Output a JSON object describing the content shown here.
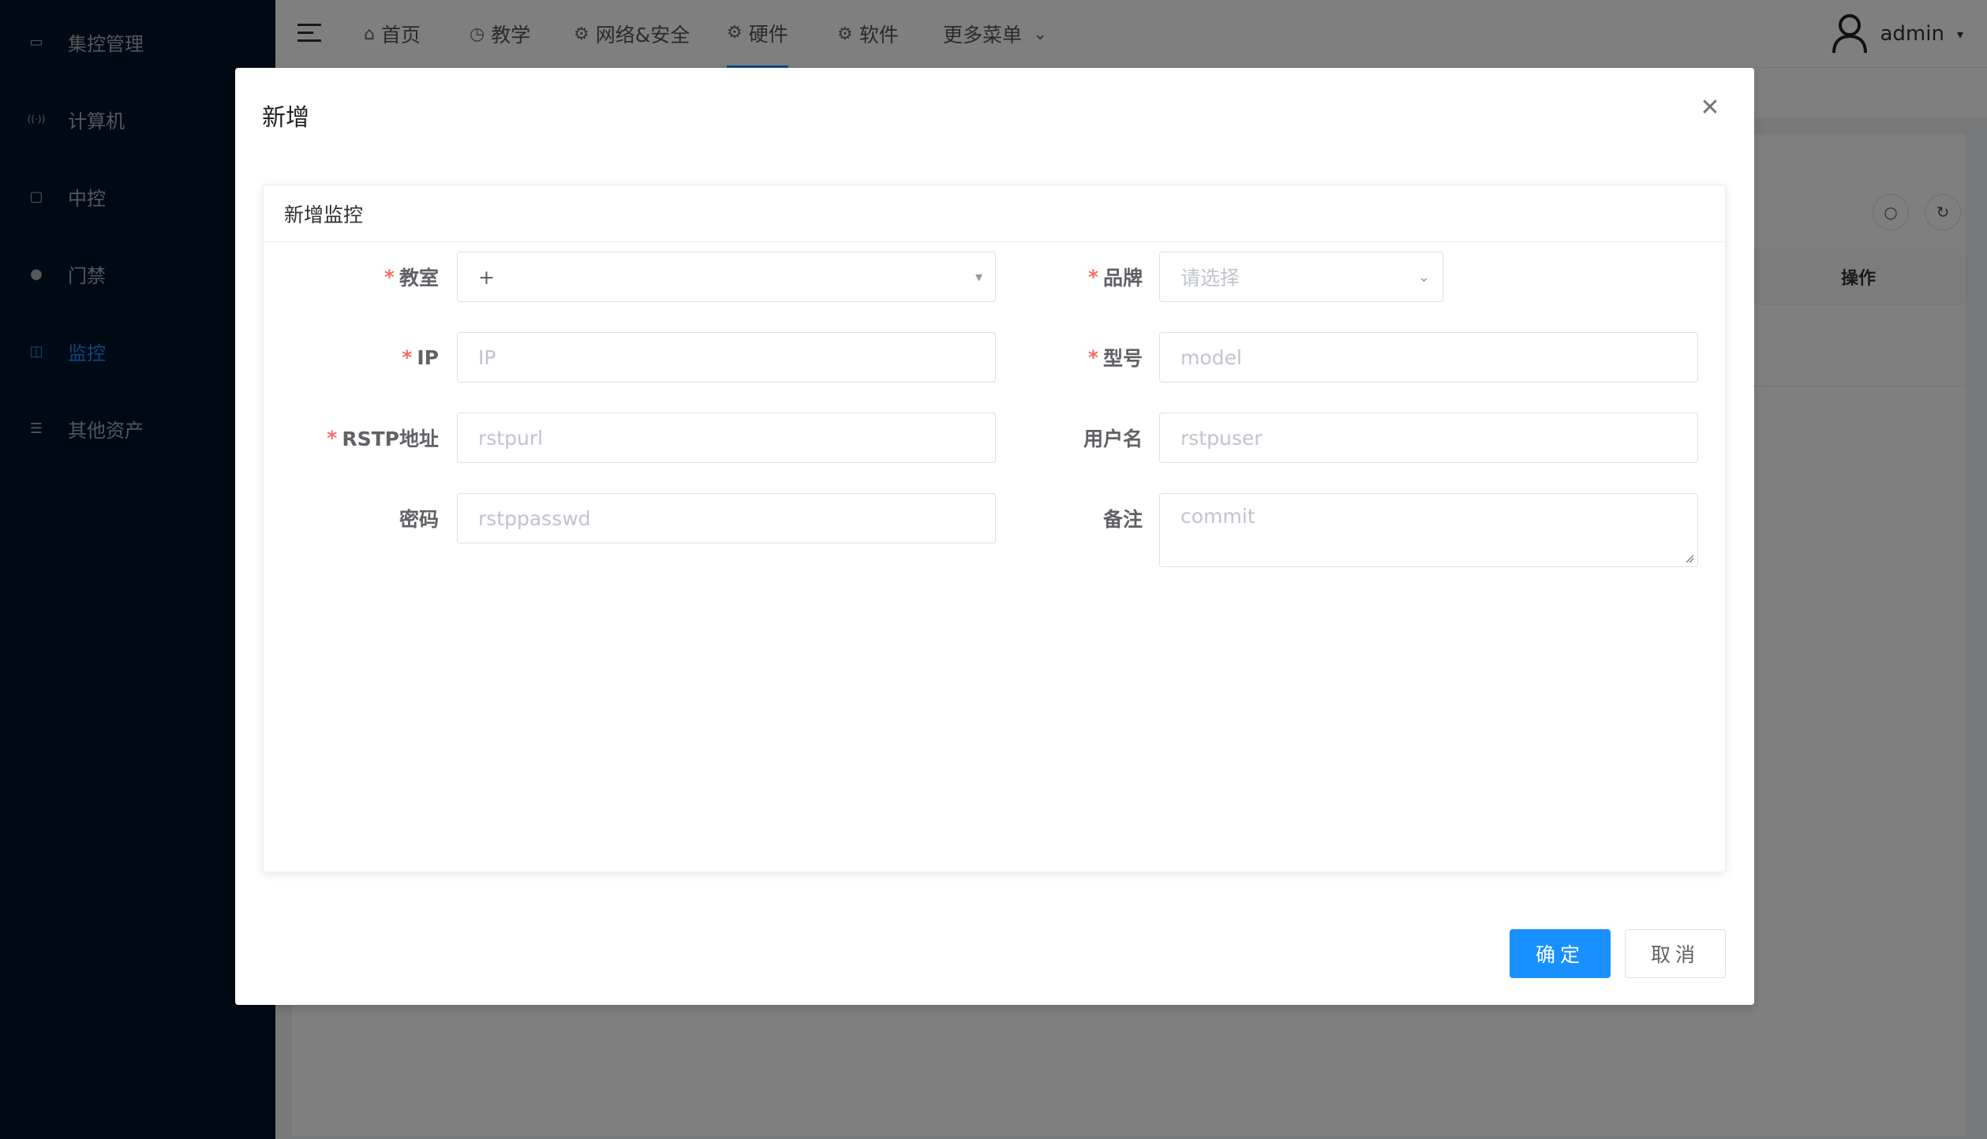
{
  "sidebar": {
    "items": [
      {
        "label": "集控管理",
        "icon": "briefcase-icon",
        "glyph": "▭"
      },
      {
        "label": "计算机",
        "icon": "broadcast-icon",
        "glyph": "((·))"
      },
      {
        "label": "中控",
        "icon": "monitor-icon",
        "glyph": "▢"
      },
      {
        "label": "门禁",
        "icon": "user-icon",
        "glyph": "●"
      },
      {
        "label": "监控",
        "icon": "camera-icon",
        "glyph": "◫"
      },
      {
        "label": "其他资产",
        "icon": "list-icon",
        "glyph": "☰"
      }
    ],
    "active_index": 4
  },
  "header": {
    "nav": [
      {
        "label": "首页",
        "icon": "home-icon",
        "glyph": "⌂"
      },
      {
        "label": "教学",
        "icon": "clock-icon",
        "glyph": "◷"
      },
      {
        "label": "网络&安全",
        "icon": "gear-icon",
        "glyph": "⚙"
      },
      {
        "label": "硬件",
        "icon": "gear-icon",
        "glyph": "⚙"
      },
      {
        "label": "软件",
        "icon": "gear-icon",
        "glyph": "⚙"
      },
      {
        "label": "更多菜单",
        "icon": "chevron-down-icon",
        "glyph": "⌄"
      }
    ],
    "active_index": 3,
    "user": {
      "name": "admin",
      "caret": "▾"
    }
  },
  "table": {
    "action_header": "操作",
    "search_glyph": "○",
    "refresh_glyph": "↻"
  },
  "modal": {
    "title": "新增",
    "close_glyph": "✕",
    "section_title": "新增监控",
    "fields": {
      "classroom": {
        "label": "教室",
        "value": "+",
        "arrow": "▾"
      },
      "brand": {
        "label": "品牌",
        "placeholder": "请选择",
        "arrow": "⌄"
      },
      "ip": {
        "label": "IP",
        "placeholder": "IP"
      },
      "model": {
        "label": "型号",
        "placeholder": "model"
      },
      "rtsp": {
        "label": "RSTP地址",
        "placeholder": "rstpurl"
      },
      "username": {
        "label": "用户名",
        "placeholder": "rstpuser"
      },
      "password": {
        "label": "密码",
        "placeholder": "rstppasswd"
      },
      "remark": {
        "label": "备注",
        "placeholder": "commit"
      }
    },
    "required_mark": "*",
    "ok_label": "确定",
    "cancel_label": "取消"
  },
  "colors": {
    "primary": "#1890ff",
    "sidebar_bg": "#001529",
    "required": "#f56c6c"
  }
}
